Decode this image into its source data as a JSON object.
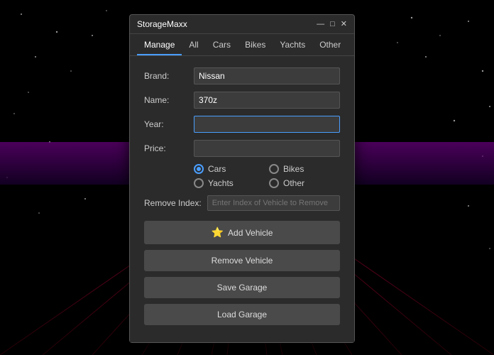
{
  "background": {
    "gridColor": "#cc0044"
  },
  "window": {
    "title": "StorageMaxx",
    "controls": {
      "minimize": "—",
      "maximize": "□",
      "close": "✕"
    }
  },
  "nav": {
    "tabs": [
      {
        "label": "Manage",
        "active": true
      },
      {
        "label": "All",
        "active": false
      },
      {
        "label": "Cars",
        "active": false
      },
      {
        "label": "Bikes",
        "active": false
      },
      {
        "label": "Yachts",
        "active": false
      },
      {
        "label": "Other",
        "active": false
      }
    ]
  },
  "form": {
    "brand_label": "Brand:",
    "brand_value": "Nissan",
    "name_label": "Name:",
    "name_value": "370z",
    "year_label": "Year:",
    "year_value": "",
    "price_label": "Price:",
    "price_value": "",
    "remove_index_label": "Remove Index:",
    "remove_index_placeholder": "Enter Index of Vehicle to Remove"
  },
  "radio_options": [
    {
      "label": "Cars",
      "checked": true
    },
    {
      "label": "Bikes",
      "checked": false
    },
    {
      "label": "Yachts",
      "checked": false
    },
    {
      "label": "Other",
      "checked": false
    }
  ],
  "buttons": {
    "add": "Add Vehicle",
    "remove": "Remove Vehicle",
    "save": "Save Garage",
    "load": "Load Garage",
    "add_icon": "⭐"
  }
}
